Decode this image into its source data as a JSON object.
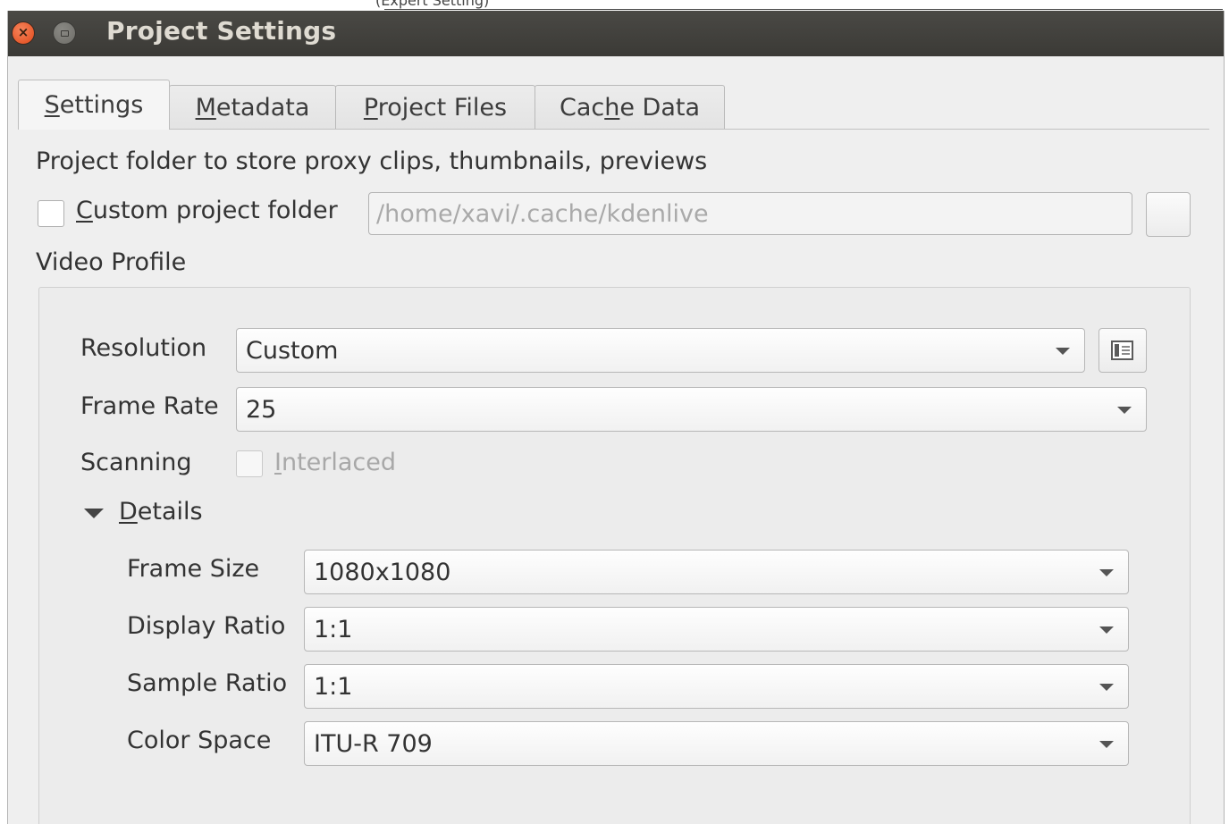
{
  "window": {
    "title": "Project Settings",
    "top_cropped_text": "(Expert Setting)"
  },
  "tabs": [
    {
      "label": "Settings",
      "mnemonic": "S",
      "active": true
    },
    {
      "label": "Metadata",
      "mnemonic": "M",
      "active": false
    },
    {
      "label": "Project Files",
      "mnemonic": "P",
      "active": false
    },
    {
      "label": "Cache Data",
      "mnemonic": "h",
      "active": false
    }
  ],
  "settings": {
    "project_folder_heading": "Project folder to store proxy clips, thumbnails, previews",
    "custom_folder": {
      "label_mnemonic": "C",
      "label_rest": "ustom project folder",
      "checked": false,
      "path": "/home/xavi/.cache/kdenlive"
    },
    "video_profile_heading": "Video Profile",
    "video_profile": {
      "resolution": {
        "label": "Resolution",
        "value": "Custom"
      },
      "frame_rate": {
        "label": "Frame Rate",
        "value": "25"
      },
      "scanning": {
        "label": "Scanning",
        "option_mnemonic": "I",
        "option_rest": "nterlaced",
        "checked": false,
        "enabled": false
      },
      "details": {
        "label_mnemonic": "D",
        "label_rest": "etails",
        "expanded": true,
        "frame_size": {
          "label": "Frame Size",
          "value": "1080x1080"
        },
        "display_ratio": {
          "label": "Display Ratio",
          "value": "1:1"
        },
        "sample_ratio": {
          "label": "Sample Ratio",
          "value": "1:1"
        },
        "color_space": {
          "label": "Color Space",
          "value": "ITU-R 709"
        }
      }
    }
  },
  "colors": {
    "titlebar": "#3c3b37",
    "title_text": "#dfdbd2",
    "close_button": "#e95420",
    "dialog_bg": "#efefef"
  }
}
